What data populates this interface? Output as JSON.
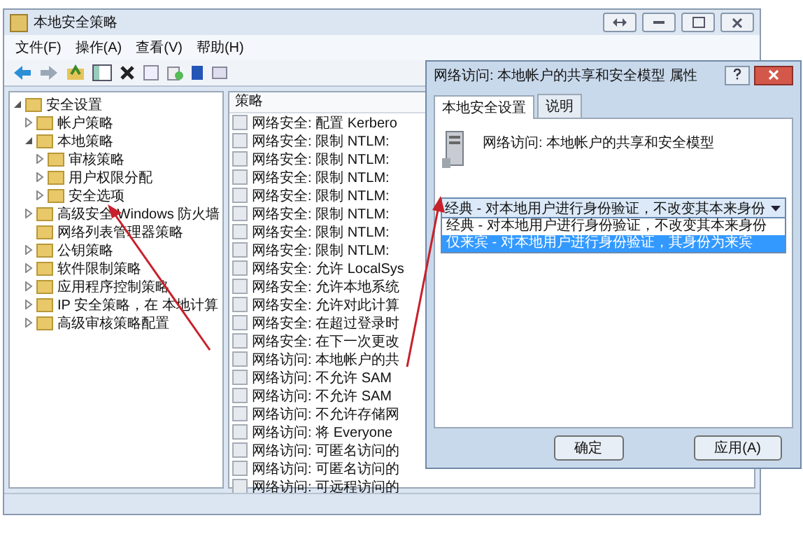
{
  "window": {
    "title": "本地安全策略"
  },
  "menu": [
    "文件(F)",
    "操作(A)",
    "查看(V)",
    "帮助(H)"
  ],
  "tree": [
    {
      "label": "安全设置",
      "expanded": true,
      "children": [
        {
          "label": "帐户策略",
          "expanded": false
        },
        {
          "label": "本地策略",
          "expanded": true,
          "children": [
            {
              "label": "审核策略",
              "expanded": false
            },
            {
              "label": "用户权限分配",
              "expanded": false
            },
            {
              "label": "安全选项",
              "expanded": false
            }
          ]
        },
        {
          "label": "高级安全 Windows 防火墙",
          "expanded": false
        },
        {
          "label": "网络列表管理器策略"
        },
        {
          "label": "公钥策略",
          "expanded": false
        },
        {
          "label": "软件限制策略",
          "expanded": false
        },
        {
          "label": "应用程序控制策略",
          "expanded": false
        },
        {
          "label": "IP 安全策略，在 本地计算",
          "expanded": false
        },
        {
          "label": "高级审核策略配置",
          "expanded": false
        }
      ]
    }
  ],
  "policy_list": {
    "column": "策略",
    "rows": [
      "网络安全: 配置 Kerbero",
      "网络安全: 限制 NTLM:",
      "网络安全: 限制 NTLM:",
      "网络安全: 限制 NTLM:",
      "网络安全: 限制 NTLM:",
      "网络安全: 限制 NTLM:",
      "网络安全: 限制 NTLM:",
      "网络安全: 限制 NTLM:",
      "网络安全: 允许 LocalSys",
      "网络安全: 允许本地系统",
      "网络安全: 允许对此计算",
      "网络安全: 在超过登录时",
      "网络安全: 在下一次更改",
      "网络访问: 本地帐户的共",
      "网络访问: 不允许 SAM",
      "网络访问: 不允许 SAM",
      "网络访问: 不允许存储网",
      "网络访问: 将 Everyone",
      "网络访问: 可匿名访问的",
      "网络访问: 可匿名访问的",
      "网络访问: 可远程访问的"
    ]
  },
  "dialog": {
    "title": "网络访问: 本地帐户的共享和安全模型 属性",
    "tabs": [
      {
        "label": "本地安全设置",
        "selected": true
      },
      {
        "label": "说明",
        "selected": false
      }
    ],
    "policy_name": "网络访问: 本地帐户的共享和安全模型",
    "dropdown": {
      "value": "经典 - 对本地用户进行身份验证，不改变其本来身份",
      "options": [
        {
          "label": "经典 - 对本地用户进行身份验证，不改变其本来身份",
          "highlighted": false
        },
        {
          "label": "仅来宾 - 对本地用户进行身份验证，其身份为来宾",
          "highlighted": true
        }
      ]
    },
    "buttons": [
      "确定",
      "应用(A)"
    ]
  }
}
